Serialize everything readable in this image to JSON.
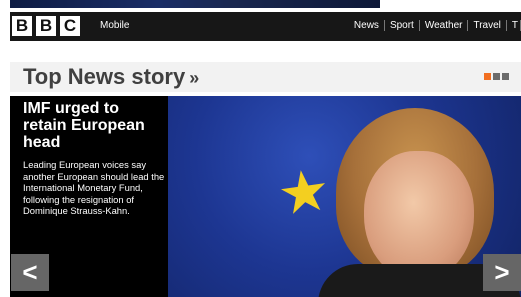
{
  "brand": {
    "logo_letters": [
      "B",
      "B",
      "C"
    ],
    "subtitle": "Mobile"
  },
  "nav": {
    "items": [
      "News",
      "Sport",
      "Weather",
      "Travel",
      "T"
    ]
  },
  "section": {
    "title": "Top News story",
    "arrow": "»"
  },
  "pager": {
    "count": 3,
    "active_index": 0,
    "active_color": "#f26f21",
    "inactive_color": "#6b6b6b"
  },
  "story": {
    "title": "IMF urged to retain European head",
    "summary": "Leading European voices say another European should lead the International Monetary Fund, following the resignation of Dominique Strauss-Kahn.",
    "prev_glyph": "<",
    "next_glyph": ">"
  }
}
